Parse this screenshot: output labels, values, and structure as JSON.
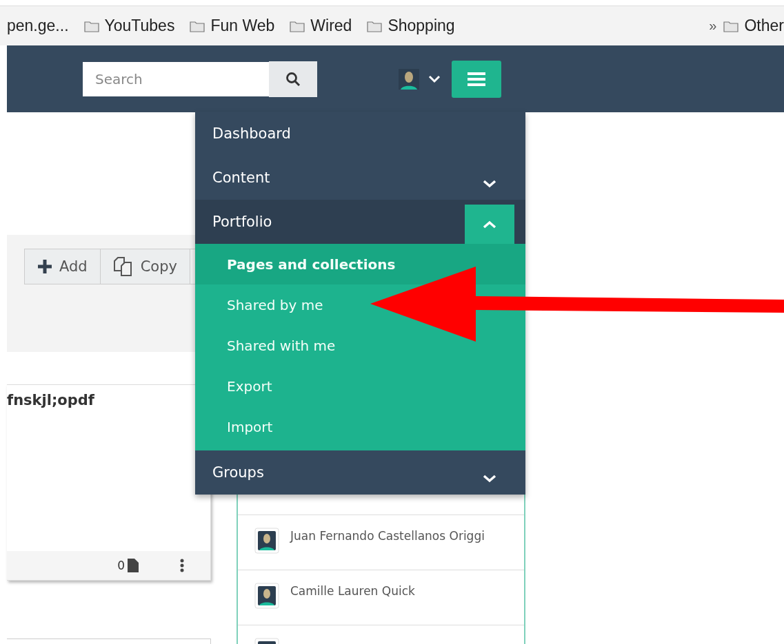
{
  "bookmarks": [
    {
      "label": "pen.ge...",
      "kind": "site"
    },
    {
      "label": "YouTubes",
      "kind": "folder"
    },
    {
      "label": "Fun Web",
      "kind": "folder"
    },
    {
      "label": "Wired",
      "kind": "folder"
    },
    {
      "label": "Shopping",
      "kind": "folder"
    }
  ],
  "bookmarks_overflow": {
    "chevron": "»",
    "label": "Other"
  },
  "header": {
    "search": {
      "placeholder": "Search"
    }
  },
  "nav": [
    {
      "label": "Dashboard",
      "kind": "link",
      "selected": false
    },
    {
      "label": "Content",
      "kind": "toggle",
      "expanded": false,
      "selected": false
    },
    {
      "label": "Portfolio",
      "kind": "toggle",
      "expanded": true,
      "selected": true,
      "children": [
        {
          "label": "Pages and collections",
          "selected": true
        },
        {
          "label": "Shared by me",
          "selected": false
        },
        {
          "label": "Shared with me",
          "selected": false
        },
        {
          "label": "Export",
          "selected": false
        },
        {
          "label": "Import",
          "selected": false
        }
      ]
    },
    {
      "label": "Groups",
      "kind": "toggle",
      "expanded": false,
      "selected": false
    }
  ],
  "toolbar": [
    {
      "label": "Add",
      "kind": "add"
    },
    {
      "label": "Copy",
      "kind": "copy"
    }
  ],
  "card": {
    "title": "fnskjl;opdf",
    "count": "0"
  },
  "people": [
    "Juan Fernando Castellanos Origgi",
    "Camille Lauren Quick"
  ]
}
